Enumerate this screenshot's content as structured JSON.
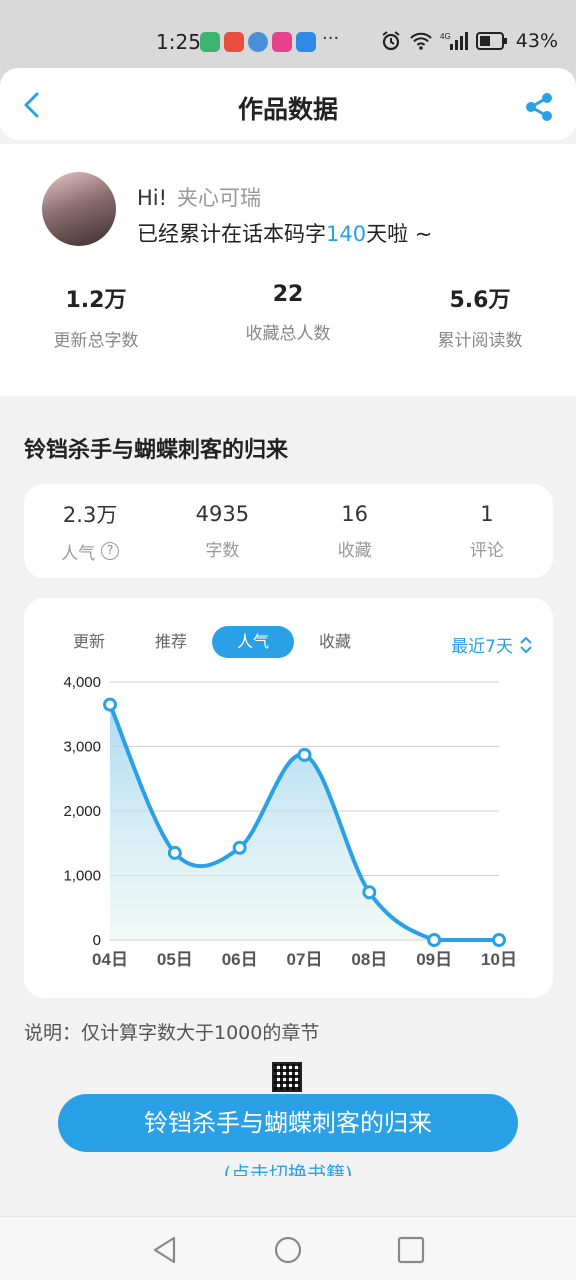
{
  "status": {
    "time": "1:25",
    "more": "···",
    "battery": "43%",
    "network": "4G"
  },
  "header": {
    "title": "作品数据"
  },
  "profile": {
    "hi": "Hi!",
    "nickname": "夹心可瑞",
    "summary_prefix": "已经累计在话本码字",
    "days": "140",
    "summary_suffix": "天啦 ~",
    "stats": [
      {
        "value": "1.2万",
        "label": "更新总字数"
      },
      {
        "value": "22",
        "label": "收藏总人数"
      },
      {
        "value": "5.6万",
        "label": "累计阅读数"
      }
    ]
  },
  "book": {
    "title": "铃铛杀手与蝴蝶刺客的归来",
    "stats": [
      {
        "value": "2.3万",
        "label": "人气"
      },
      {
        "value": "4935",
        "label": "字数"
      },
      {
        "value": "16",
        "label": "收藏"
      },
      {
        "value": "1",
        "label": "评论"
      }
    ]
  },
  "chart": {
    "tabs": [
      "更新",
      "推荐",
      "人气",
      "收藏"
    ],
    "active_tab": "人气",
    "range": "最近7天"
  },
  "chart_data": {
    "type": "area",
    "x": [
      "04日",
      "05日",
      "06日",
      "07日",
      "08日",
      "09日",
      "10日"
    ],
    "values": [
      3650,
      1350,
      1430,
      2870,
      740,
      0,
      0
    ],
    "ylim": [
      0,
      4000
    ],
    "yticks": [
      "4,000",
      "3,000",
      "2,000",
      "1,000",
      "0"
    ],
    "ytick_values": [
      4000,
      3000,
      2000,
      1000,
      0
    ],
    "grid": true,
    "color": "#2aa0e6"
  },
  "note": "说明：仅计算字数大于1000的章节",
  "switch": {
    "button_label": "铃铛杀手与蝴蝶刺客的归来",
    "hint": "(点击切换书籍)"
  }
}
